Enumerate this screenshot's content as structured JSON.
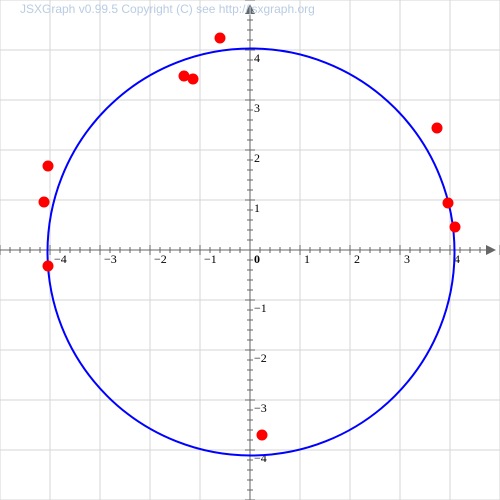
{
  "copyright": "JSXGraph v0.99.5 Copyright (C) see http://jsxgraph.org",
  "colors": {
    "grid": "#d4d4d4",
    "axis": "#666666",
    "circle": "#0000ff",
    "point": "#ff0000",
    "copyright": "#b9cce3"
  },
  "axes": {
    "x_range": [
      -5,
      5
    ],
    "y_range": [
      -5,
      5
    ],
    "grid": true,
    "x_ticks": [
      {
        "value": -4,
        "label": "−4"
      },
      {
        "value": -3,
        "label": "−3"
      },
      {
        "value": -2,
        "label": "−2"
      },
      {
        "value": -1,
        "label": "−1"
      },
      {
        "value": 0,
        "label": "0"
      },
      {
        "value": 1,
        "label": "1"
      },
      {
        "value": 2,
        "label": "2"
      },
      {
        "value": 3,
        "label": "3"
      },
      {
        "value": 4,
        "label": "4"
      }
    ],
    "y_ticks": [
      {
        "value": 4,
        "label": "4"
      },
      {
        "value": 3,
        "label": "3"
      },
      {
        "value": 2,
        "label": "2"
      },
      {
        "value": 1,
        "label": "1"
      },
      {
        "value": -1,
        "label": "−1"
      },
      {
        "value": -2,
        "label": "−2"
      },
      {
        "value": -3,
        "label": "−3"
      },
      {
        "value": -4,
        "label": "−4"
      }
    ]
  },
  "circle": {
    "center": [
      0.02,
      -0.04
    ],
    "radius": 4.07
  },
  "points": [
    {
      "x": -0.6,
      "y": 4.24
    },
    {
      "x": -1.32,
      "y": 3.48
    },
    {
      "x": -1.14,
      "y": 3.42
    },
    {
      "x": -4.04,
      "y": 1.68
    },
    {
      "x": -4.12,
      "y": 0.96
    },
    {
      "x": -4.04,
      "y": -0.32
    },
    {
      "x": 3.74,
      "y": 2.44
    },
    {
      "x": 3.96,
      "y": 0.94
    },
    {
      "x": 4.1,
      "y": 0.46
    },
    {
      "x": 0.24,
      "y": -3.7
    }
  ]
}
